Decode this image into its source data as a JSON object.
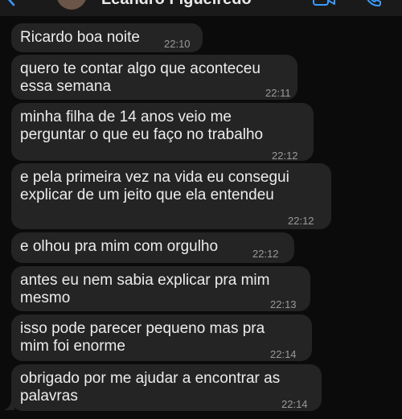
{
  "header": {
    "contact_name": "Leandro Figueiredo"
  },
  "messages": [
    {
      "lines": [
        "Ricardo boa noite"
      ],
      "time": "22:10"
    },
    {
      "lines": [
        "quero te contar algo que aconteceu",
        "essa semana"
      ],
      "time": "22:11"
    },
    {
      "lines": [
        "minha filha de 14 anos veio me",
        "perguntar o que eu faço no trabalho"
      ],
      "time": "22:12"
    },
    {
      "lines": [
        "e pela primeira vez na vida eu consegui",
        "explicar de um jeito que ela entendeu"
      ],
      "time": "22:12"
    },
    {
      "lines": [
        "e olhou pra mim com orgulho"
      ],
      "time": "22:12"
    },
    {
      "lines": [
        "antes eu nem sabia explicar pra mim",
        "mesmo"
      ],
      "time": "22:13"
    },
    {
      "lines": [
        "isso pode parecer pequeno mas pra",
        "mim foi enorme"
      ],
      "time": "22:14"
    },
    {
      "lines": [
        "obrigado por me ajudar a encontrar as",
        "palavras"
      ],
      "time": "22:14"
    }
  ]
}
